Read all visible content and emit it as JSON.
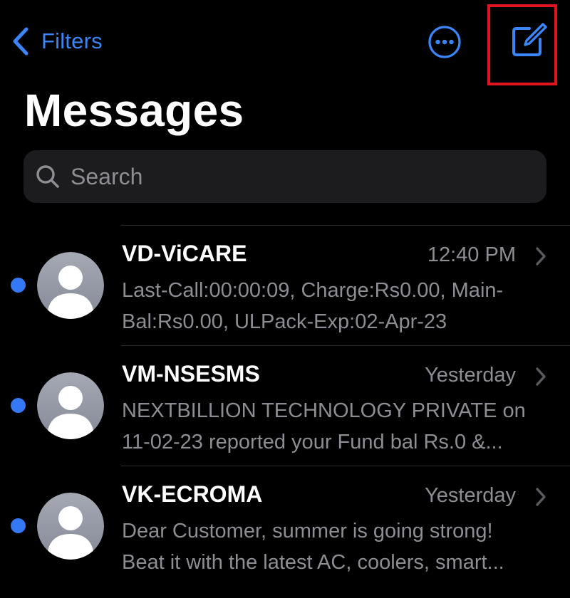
{
  "nav": {
    "back_label": "Filters"
  },
  "header": {
    "title": "Messages"
  },
  "search": {
    "placeholder": "Search",
    "value": ""
  },
  "messages": [
    {
      "sender": "VD-ViCARE",
      "time": "12:40 PM",
      "unread": true,
      "preview_line1": "Last-Call:00:00:09, Charge:Rs0.00, Main-",
      "preview_line2": "Bal:Rs0.00, ULPack-Exp:02-Apr-23"
    },
    {
      "sender": "VM-NSESMS",
      "time": "Yesterday",
      "unread": true,
      "preview_line1": "NEXTBILLION TECHNOLOGY PRIVATE on",
      "preview_line2": "11-02-23 reported your Fund bal Rs.0 &..."
    },
    {
      "sender": "VK-ECROMA",
      "time": "Yesterday",
      "unread": true,
      "preview_line1": "Dear Customer, summer is going strong!",
      "preview_line2": "Beat it with the latest AC, coolers, smart..."
    }
  ],
  "icons": {
    "back": "chevron-left-icon",
    "more": "ellipsis-circle-icon",
    "compose": "compose-icon",
    "search": "magnifying-glass-icon",
    "avatar": "person-placeholder-icon",
    "row_chevron": "chevron-right-icon"
  },
  "colors": {
    "background": "#000000",
    "accent": "#3a86f7",
    "unread_dot": "#3478f6",
    "secondary_text": "#8d8d93",
    "search_field": "#1c1c1e",
    "highlight": "#e0141f"
  }
}
